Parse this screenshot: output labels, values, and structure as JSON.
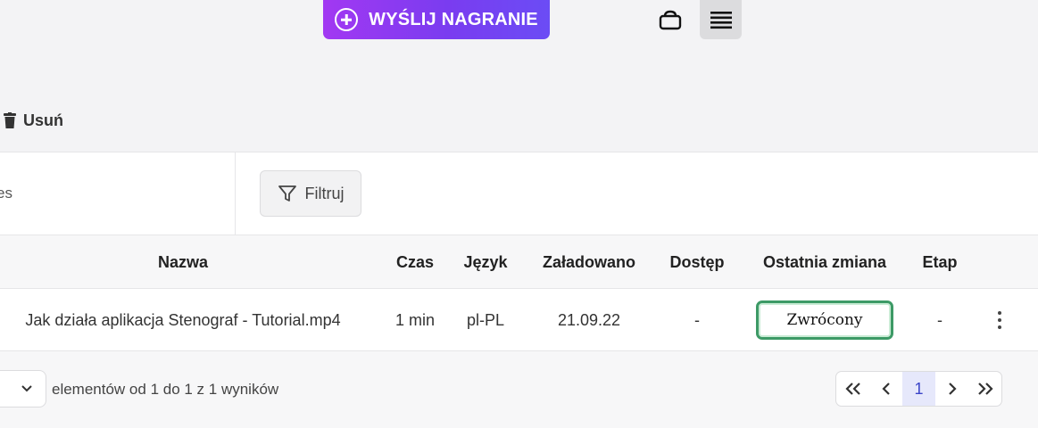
{
  "toolbar": {
    "upload_label": "WYŚLIJ NAGRANIE",
    "accent_gradient": [
      "#a238f2",
      "#6b4cf5"
    ],
    "view_grid_icon": "grid-view-icon",
    "view_list_icon": "list-view-icon",
    "active_view": "list"
  },
  "actions": {
    "delete_label": "Usuń",
    "delete_icon": "trash-icon"
  },
  "search": {
    "value_fragment": "es"
  },
  "filter": {
    "label": "Filtruj",
    "icon": "filter-icon"
  },
  "table": {
    "columns": [
      "Nazwa",
      "Czas",
      "Język",
      "Załadowano",
      "Dostęp",
      "Ostatnia zmiana",
      "Etap"
    ],
    "rows": [
      {
        "name": "Jak działa aplikacja Stenograf - Tutorial.mp4",
        "duration": "1 min",
        "language": "pl-PL",
        "uploaded": "21.09.22",
        "access": "-",
        "last_change": "Zwrócony",
        "stage": "-",
        "status_color": "#3d9a66"
      }
    ]
  },
  "footer": {
    "results_text": "elementów od 1 do 1 z 1 wyników",
    "pagination": {
      "first": "«",
      "prev": "‹",
      "current_page": "1",
      "next": "›",
      "last": "»"
    }
  }
}
